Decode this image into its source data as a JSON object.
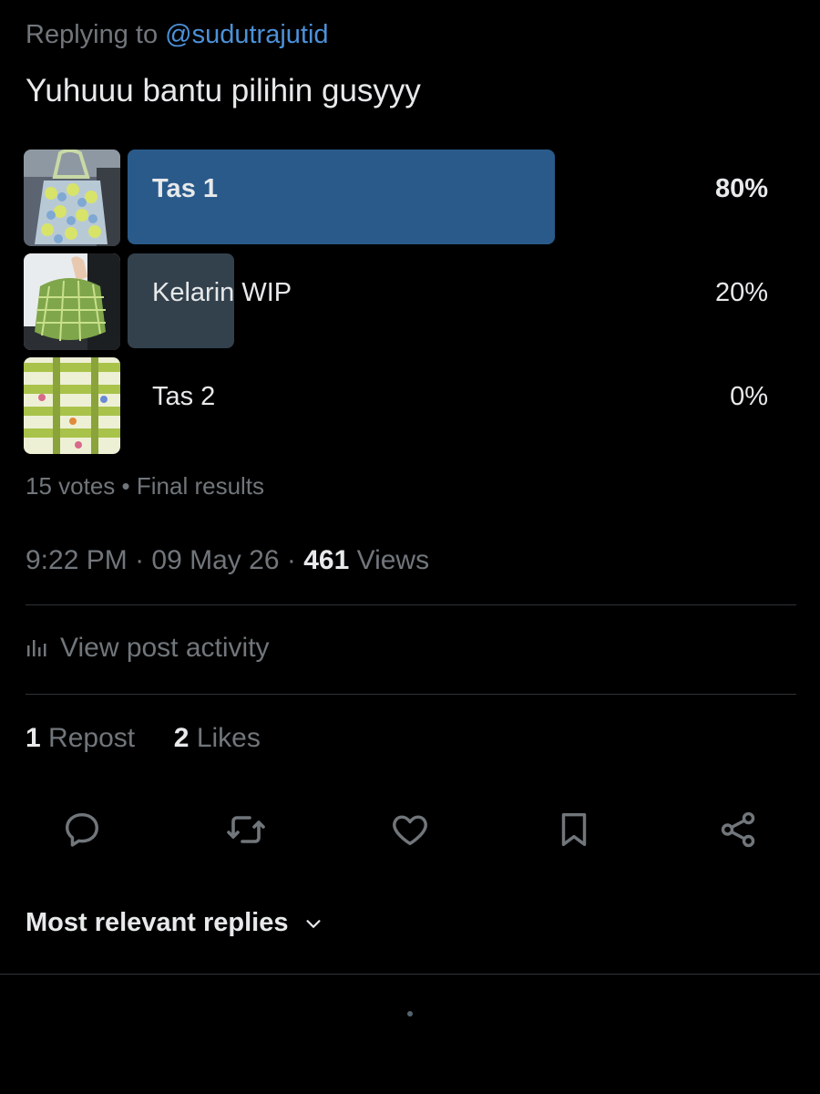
{
  "reply": {
    "prefix": "Replying to",
    "handle": "@sudutrajutid"
  },
  "tweet": {
    "text": "Yuhuuu bantu pilihin gusyyy"
  },
  "poll": {
    "options": [
      {
        "label": "Tas 1",
        "percent": "80%",
        "fraction": 0.8,
        "winner": true,
        "image": "crochet-granny-square-bag"
      },
      {
        "label": "Kelarin WIP",
        "percent": "20%",
        "fraction": 0.2,
        "winner": false,
        "image": "green-net-crochet-bag"
      },
      {
        "label": "Tas 2",
        "percent": "0%",
        "fraction": 0.0,
        "winner": false,
        "image": "striped-crochet-bag"
      }
    ],
    "votes": "15 votes",
    "separator": "•",
    "status": "Final results",
    "colors": {
      "winner_bar": "#2a5a8a",
      "other_bar": "#33414d"
    }
  },
  "post_meta": {
    "time": "9:22 PM",
    "dot1": "·",
    "date": "09 May 26",
    "dot2": "·",
    "views_count": "461",
    "views_label": "Views"
  },
  "activity": {
    "label": "View post activity",
    "icon": "bar-chart-icon"
  },
  "engagement": {
    "reposts_count": "1",
    "reposts_label": "Repost",
    "likes_count": "2",
    "likes_label": "Likes"
  },
  "actions": [
    {
      "name": "reply",
      "icon": "reply-icon"
    },
    {
      "name": "repost",
      "icon": "repost-icon"
    },
    {
      "name": "like",
      "icon": "heart-icon"
    },
    {
      "name": "bookmark",
      "icon": "bookmark-icon"
    },
    {
      "name": "share",
      "icon": "share-icon"
    }
  ],
  "replies_sort": {
    "label": "Most relevant replies",
    "icon": "chevron-down-icon"
  },
  "theme": {
    "background": "#000000",
    "text": "#e7e9ea",
    "muted": "#71767b",
    "link": "#4c91d8",
    "divider": "#2f3336"
  }
}
